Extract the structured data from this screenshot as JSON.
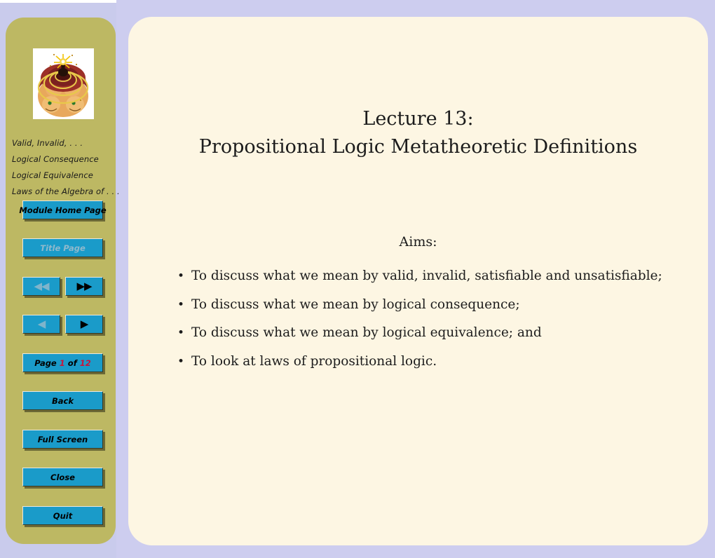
{
  "theme": {
    "background_lavender": "#cdcdef",
    "sidebar_khaki": "#bdb863",
    "panel_cream": "#fdf6e3",
    "button_blue": "#1a9bc9",
    "button_text": "#000000",
    "button_text_disabled": "#8fb9cc",
    "page_number_red": "#c9143a",
    "body_text": "#1c1c1c"
  },
  "sidebar": {
    "logo": {
      "name": "spiral-faces-logo",
      "alt": "Spiral rings with faces and a star burst"
    },
    "toc": {
      "items": [
        {
          "label": "Valid, Invalid, . . ."
        },
        {
          "label": "Logical Consequence"
        },
        {
          "label": "Logical Equivalence"
        },
        {
          "label": "Laws of the Algebra of . . ."
        }
      ]
    },
    "buttons": {
      "module_home": {
        "label": "Module Home Page",
        "enabled": true
      },
      "title_page": {
        "label": "Title Page",
        "enabled": false
      },
      "first_page": {
        "icon": "double-left-arrow-icon",
        "glyph": "◀◀",
        "enabled": false
      },
      "last_page": {
        "icon": "double-right-arrow-icon",
        "glyph": "▶▶",
        "enabled": true
      },
      "prev_page": {
        "icon": "left-arrow-icon",
        "glyph": "◀",
        "enabled": false
      },
      "next_page": {
        "icon": "right-arrow-icon",
        "glyph": "▶",
        "enabled": true
      },
      "page_indicator": {
        "prefix": "Page",
        "current": "1",
        "middle": "of",
        "total": "12"
      },
      "back": {
        "label": "Back",
        "enabled": true
      },
      "full_screen": {
        "label": "Full Screen",
        "enabled": true
      },
      "close": {
        "label": "Close",
        "enabled": true
      },
      "quit": {
        "label": "Quit",
        "enabled": true
      }
    }
  },
  "main": {
    "title_line1": "Lecture 13:",
    "title_line2": "Propositional Logic Metatheoretic Definitions",
    "aims_label": "Aims:",
    "bullet_char": "•",
    "bullets": [
      {
        "text": "To discuss what we mean by valid, invalid, satisfiable and unsatisfiable;"
      },
      {
        "text": "To discuss what we mean by logical consequence;"
      },
      {
        "text": "To discuss what we mean by logical equivalence; and"
      },
      {
        "text": "To look at laws of propositional logic."
      }
    ]
  }
}
